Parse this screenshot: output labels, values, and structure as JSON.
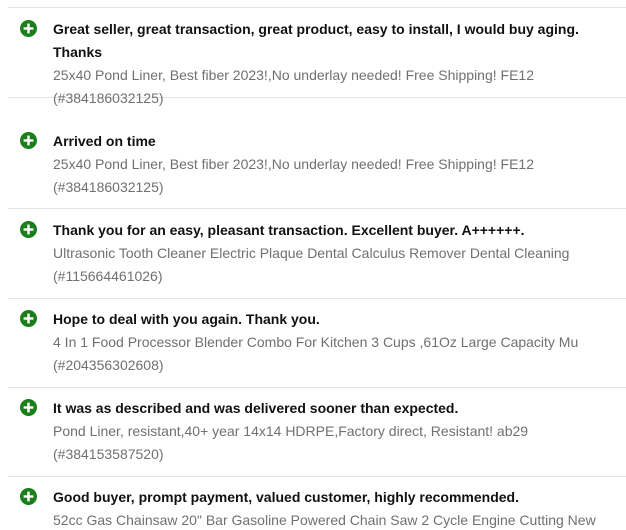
{
  "icon_color": "#1a7f1a",
  "feedback": [
    {
      "icon": "positive-plus-icon",
      "comment": "Great seller, great transaction, great product, easy to install, I would buy aging. Thanks",
      "product_title": "25x40 Pond Liner, Best fiber 2023!,No underlay needed! Free Shipping! FE12",
      "item_number": "(#384186032125)"
    },
    {
      "icon": "positive-plus-icon",
      "comment": "Arrived on time",
      "product_title": "25x40 Pond Liner, Best fiber 2023!,No underlay needed! Free Shipping! FE12",
      "item_number": "(#384186032125)"
    },
    {
      "icon": "positive-plus-icon",
      "comment": "Thank you for an easy, pleasant transaction. Excellent buyer. A++++++.",
      "product_title": "Ultrasonic Tooth Cleaner Electric Plaque Dental Calculus Remover Dental Cleaning",
      "item_number": "(#115664461026)"
    },
    {
      "icon": "positive-plus-icon",
      "comment": "Hope to deal with you again. Thank you.",
      "product_title": "4 In 1 Food Processor Blender Combo For Kitchen 3 Cups ,61Oz Large Capacity Mu",
      "item_number": "(#204356302608)"
    },
    {
      "icon": "positive-plus-icon",
      "comment": "It was as described and was delivered sooner than expected.",
      "product_title": "Pond Liner, resistant,40+ year 14x14 HDRPE,Factory direct, Resistant! ab29",
      "item_number": "(#384153587520)"
    },
    {
      "icon": "positive-plus-icon",
      "comment": "Good buyer, prompt payment, valued customer, highly recommended.",
      "product_title": "52cc Gas Chainsaw 20\" Bar Gasoline Powered Chain Saw 2 Cycle Engine Cutting New",
      "item_number": ""
    }
  ]
}
